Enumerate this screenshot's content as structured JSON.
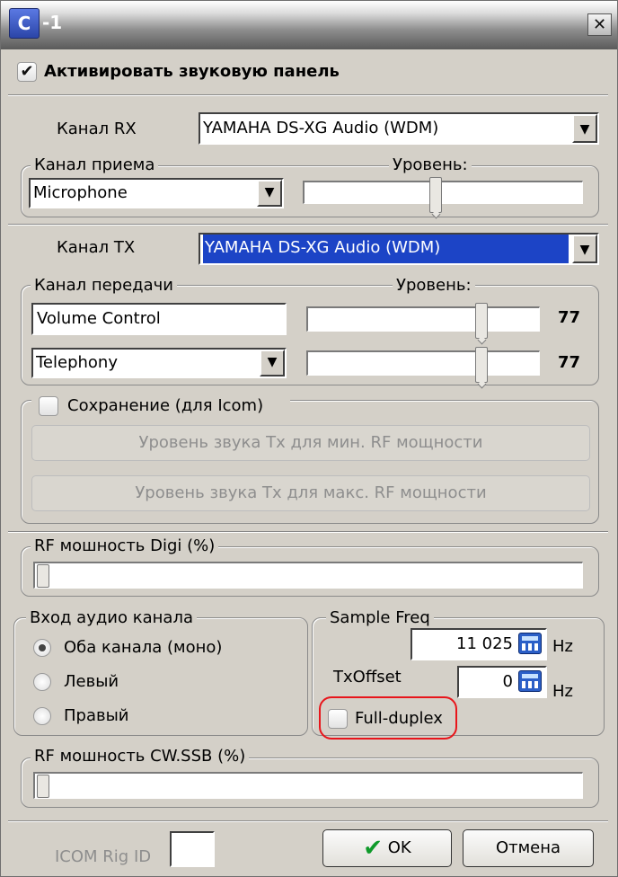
{
  "window": {
    "title": "-1",
    "app_icon": "app-icon",
    "close_icon": "close-icon"
  },
  "activate": {
    "label": "Активировать звуковую панель",
    "checked": true
  },
  "rx": {
    "channel_label": "Канал RX",
    "channel_value": "YAMAHA DS-XG Audio (WDM)",
    "group_label": "Канал приема",
    "level_label": "Уровень:",
    "input_value": "Microphone",
    "level_fraction": 0.47
  },
  "tx": {
    "channel_label": "Канал TX",
    "channel_value": "YAMAHA DS-XG Audio (WDM)",
    "group_label": "Канал передачи",
    "level_label": "Уровень:",
    "control1_value": "Volume Control",
    "control1_level": "77",
    "control2_value": "Telephony",
    "control2_level": "77"
  },
  "icom_save": {
    "label": "Сохранение (для Icom)",
    "checked": false,
    "min_button": "Уровень звука Tx для мин. RF мощности",
    "max_button": "Уровень звука Tx для макс. RF мощности"
  },
  "rf_digi": {
    "label": "RF мошность Digi (%)",
    "value_fraction": 0.0
  },
  "audio_input": {
    "label": "Вход аудио канала",
    "options": [
      "Оба канала (моно)",
      "Левый",
      "Правый"
    ],
    "selected": "Оба канала (моно)"
  },
  "sample": {
    "label": "Sample Freq",
    "freq_value": "11 025",
    "freq_unit": "Hz",
    "txoffset_label": "TxOffset",
    "txoffset_value": "0",
    "txoffset_unit": "Hz",
    "full_duplex_label": "Full-duplex",
    "full_duplex_checked": false,
    "calc_icon": "calculator-icon"
  },
  "rf_cw": {
    "label": "RF мошность CW.SSB (%)",
    "value_fraction": 0.0
  },
  "footer": {
    "icom_rig_label": "ICOM Rig ID",
    "icom_rig_value": "",
    "ok_label": "OK",
    "ok_icon": "checkmark-icon",
    "cancel_label": "Отмена"
  },
  "colors": {
    "highlight": "#1c44c6",
    "annotation_ring": "#e8151b",
    "dialog_bg": "#d4d0c8"
  }
}
